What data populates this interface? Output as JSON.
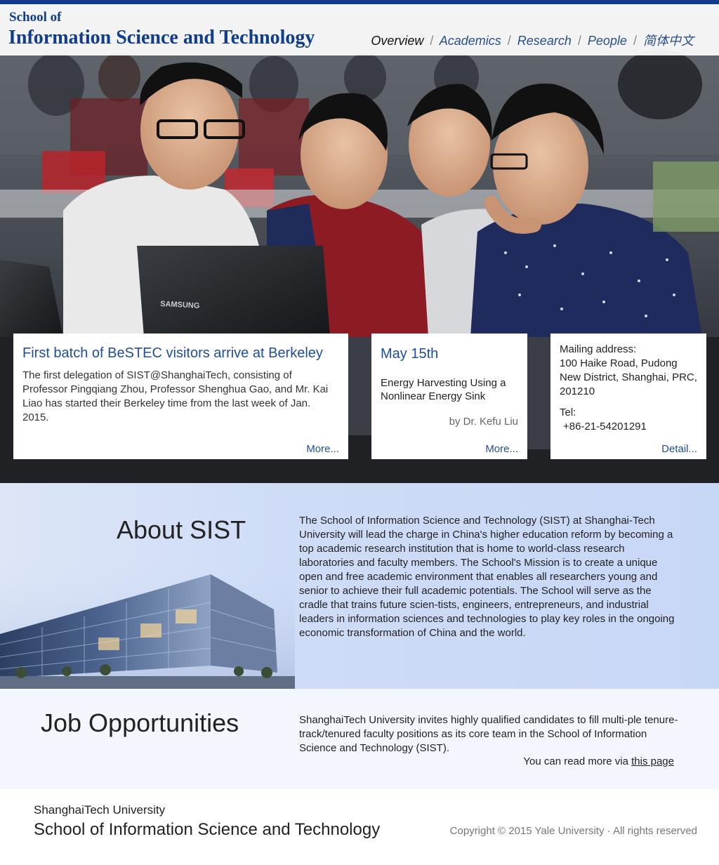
{
  "header": {
    "logo_small": "School of",
    "logo_big": "Information Science and Technology",
    "nav": {
      "overview": "Overview",
      "academics": "Academics",
      "research": "Research",
      "people": "People",
      "chinese": "简体中文",
      "separator": "/"
    }
  },
  "hero_photo": {
    "camera_brand": "SAMSUNG"
  },
  "news_card": {
    "title": "First batch of BeSTEC visitors arrive at Berkeley",
    "body": "The first delegation of SIST@ShanghaiTech, consisting of Professor Pingqiang Zhou, Professor Shenghua Gao, and Mr. Kai Liao has started their Berkeley time from the last week of Jan. 2015.",
    "more": "More..."
  },
  "event_card": {
    "date": "May 15th",
    "title": "Energy Harvesting Using a Nonlinear Energy Sink",
    "speaker": "by Dr. Kefu Liu",
    "more": "More..."
  },
  "contact_card": {
    "mailing_label": "Mailing address:",
    "address": "100 Haike Road, Pudong New District, Shanghai, PRC, 201210",
    "tel_label": "Tel:",
    "tel": "+86-21-54201291",
    "detail": "Detail..."
  },
  "about": {
    "heading": "About SIST",
    "text": "The School of Information Science and Technology (SIST) at Shanghai-Tech University will lead the charge in China's higher education reform by becoming a top academic research institution that is home to world-class research laboratories and faculty members. The School's Mission is to create a unique open and free academic environment that enables all researchers young and senior to achieve their full academic potentials.  The School will serve as the cradle that trains future scien-tists,  engineers, entrepreneurs, and industrial leaders in information sciences and technologies to play key roles in the ongoing economic transformation of China and the world."
  },
  "jobs": {
    "heading": "Job Opportunities",
    "text": "ShanghaiTech University invites highly qualified candidates to fill multi-ple tenure-track/tenured faculty positions as its core team in the School of Information Science and Technology (SIST).",
    "more_prefix": "You can read more via ",
    "more_link": "this page"
  },
  "footer": {
    "university": "ShanghaiTech University",
    "school": "School of Information Science and Technology",
    "copyright": "Copyright © 2015 Yale University · All rights reserved"
  },
  "colors": {
    "brand_blue": "#0f3d8c",
    "link_blue": "#1f4e9a",
    "about_bg": "#cfdcf7",
    "jobs_bg": "#f3f6fd"
  }
}
